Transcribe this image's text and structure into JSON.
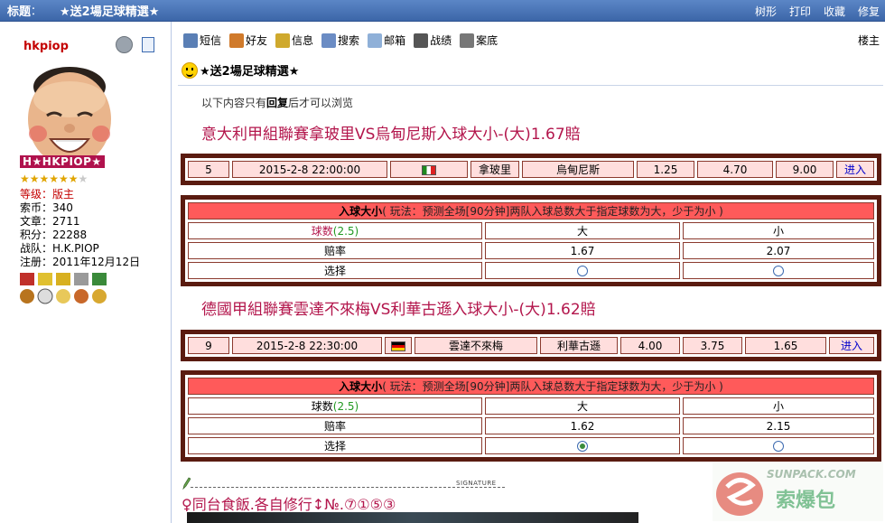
{
  "topbar": {
    "label": "标题",
    "colon": "：",
    "title": "★送2場足球精選★",
    "links": [
      "树形",
      "打印",
      "收藏",
      "修复"
    ]
  },
  "user": {
    "name": "hkpiop",
    "handle": "H★HKPIOP★",
    "stars_full": "★★★★★★",
    "stars_empty": "★",
    "level_label": "等级：",
    "level_value": "版主",
    "lines": [
      "索币：340",
      "文章：2711",
      "积分：22288",
      "战队：H.K.PIOP",
      "注册：2011年12月12日"
    ]
  },
  "toolbar": {
    "items": [
      {
        "label": "短信",
        "icon": "mail-icon",
        "color": "#5a7fb5"
      },
      {
        "label": "好友",
        "icon": "friends-icon",
        "color": "#d07a2b"
      },
      {
        "label": "信息",
        "icon": "info-icon",
        "color": "#cfa92d"
      },
      {
        "label": "搜索",
        "icon": "search-icon",
        "color": "#6b8cc4"
      },
      {
        "label": "邮箱",
        "icon": "mailbox-icon",
        "color": "#8fb0d8"
      },
      {
        "label": "战绩",
        "icon": "record-icon",
        "color": "#555555"
      },
      {
        "label": "案底",
        "icon": "monitor-icon",
        "color": "#777777"
      }
    ],
    "louzhu": "楼主"
  },
  "post": {
    "title": "★送2場足球精選★",
    "notice_prefix": "以下内容只有",
    "notice_bold": "回复",
    "notice_suffix": "后才可以浏览"
  },
  "matches": [
    {
      "title": "意大利甲組聯賽拿玻里VS烏甸尼斯入球大小-(大)1.67賠",
      "no": "5",
      "datetime": "2015-2-8 22:00:00",
      "flag": "italy-flag-icon",
      "home": "拿玻里",
      "away": "烏甸尼斯",
      "odds": [
        "1.25",
        "4.70",
        "9.00"
      ],
      "go": "进入",
      "market": "入球大小",
      "rule": "( 玩法：预测全场[90分钟]两队入球总数大于指定球数为大，少于为小 )",
      "ball_label": "球数",
      "ball_value": "(2.5)",
      "big": "大",
      "small": "小",
      "rate_label": "赔率",
      "rate_big": "1.67",
      "rate_small": "2.07",
      "choose_label": "选择",
      "checked": "none"
    },
    {
      "title": "德國甲組聯賽雲達不來梅VS利華古遜入球大小-(大)1.62賠",
      "no": "9",
      "datetime": "2015-2-8 22:30:00",
      "flag": "germany-flag-icon",
      "home": "雲達不來梅",
      "away": "利華古遜",
      "odds": [
        "4.00",
        "3.75",
        "1.65"
      ],
      "go": "进入",
      "market": "入球大小",
      "rule": "( 玩法：预测全场[90分钟]两队入球总数大于指定球数为大，少于为小 )",
      "ball_label": "球数",
      "ball_value": "(2.5)",
      "big": "大",
      "small": "小",
      "rate_label": "赔率",
      "rate_big": "1.62",
      "rate_small": "2.15",
      "choose_label": "选择",
      "checked": "big"
    }
  ],
  "signature": {
    "tag": "SIGNATURE",
    "text": "♀同台食飯.各自修行↕№.⑦①⑤③"
  },
  "watermark": {
    "site": "SUNPACK.COM",
    "brand": "索爆包"
  },
  "colors": {
    "topbar": "#3c66a8",
    "frame": "#5a1b10",
    "header_red": "#ff5a5a",
    "row_pink": "#ffdedd",
    "title_red": "#b3164c"
  }
}
